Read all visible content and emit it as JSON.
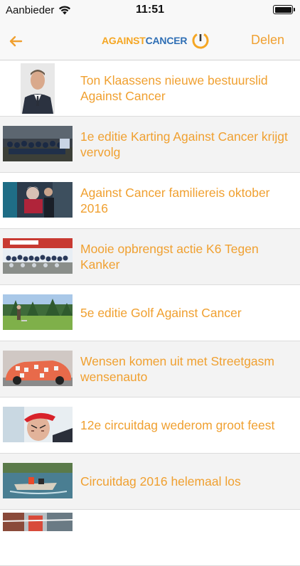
{
  "status": {
    "carrier": "Aanbieder",
    "time": "11:51"
  },
  "nav": {
    "logo_part1": "AGAINST",
    "logo_part2": "CANCER",
    "share_label": "Delen"
  },
  "colors": {
    "accent": "#f0a030",
    "logo_blue": "#2f6fb5"
  },
  "items": [
    {
      "title": "Ton Klaassens nieuwe bestuurslid Against Cancer"
    },
    {
      "title": "1e editie Karting Against Cancer krijgt vervolg"
    },
    {
      "title": "Against Cancer familiereis oktober 2016"
    },
    {
      "title": "Mooie opbrengst actie K6 Tegen Kanker"
    },
    {
      "title": "5e editie Golf Against Cancer"
    },
    {
      "title": "Wensen komen uit met Streetgasm wensenauto"
    },
    {
      "title": "12e circuitdag wederom groot feest"
    },
    {
      "title": "Circuitdag 2016 helemaal los"
    },
    {
      "title": ""
    }
  ]
}
